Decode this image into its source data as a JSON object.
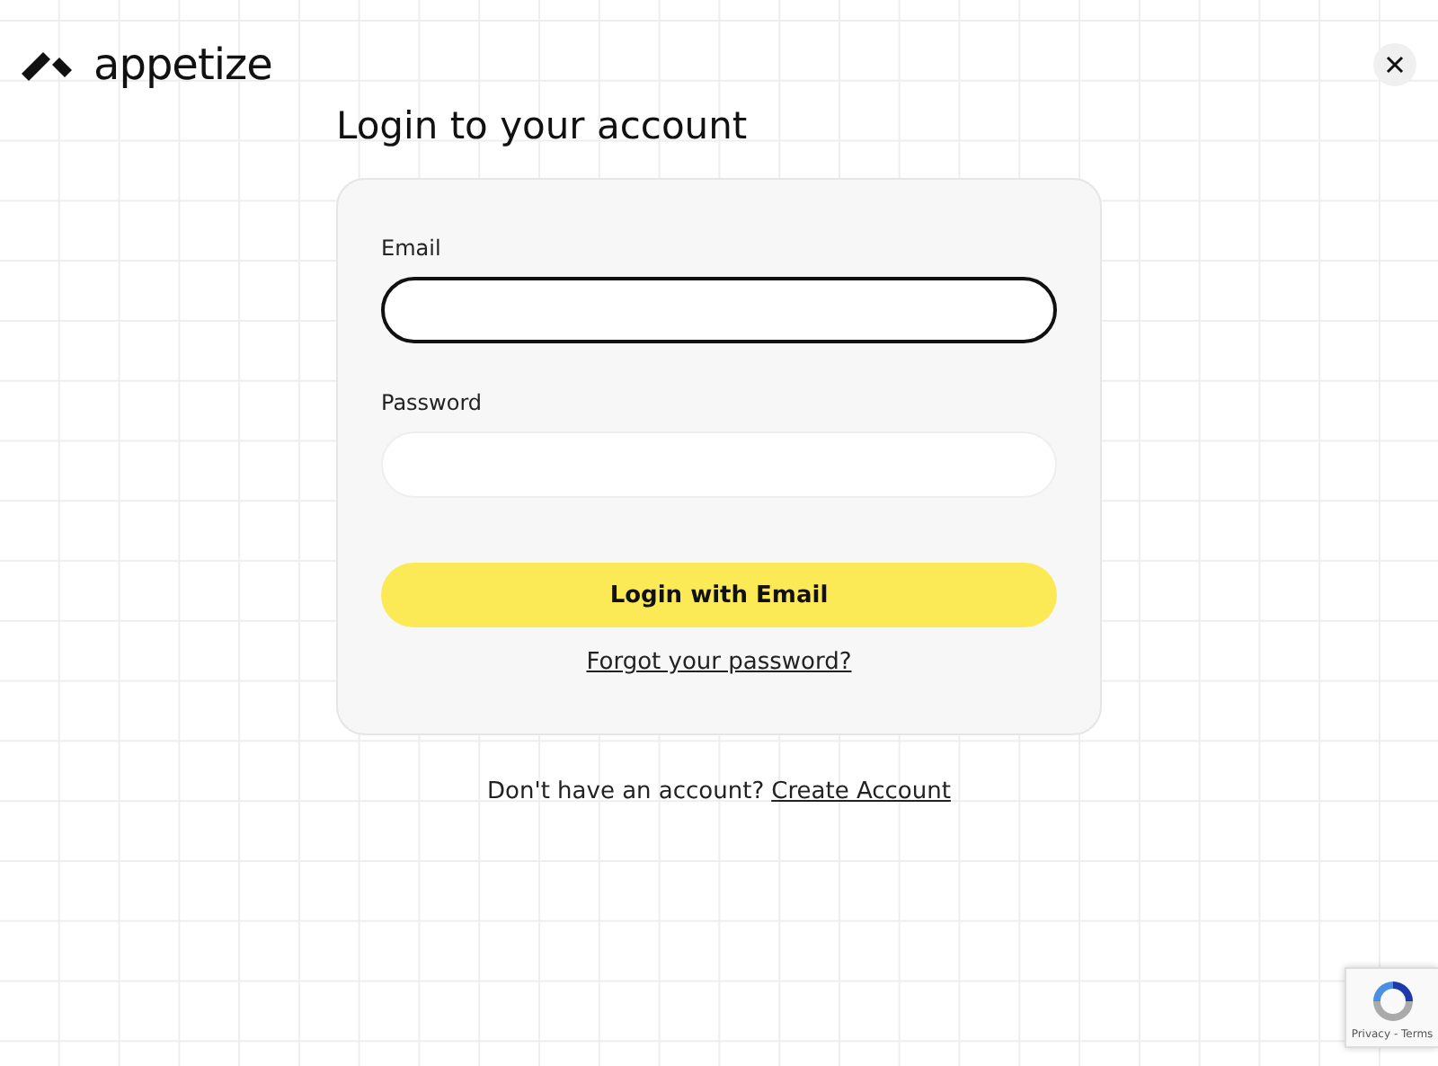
{
  "header": {
    "logo": "appetize"
  },
  "title": "Login to your account",
  "form": {
    "fields": [
      {
        "label": "Email",
        "focused": true
      },
      {
        "label": "Password",
        "focused": false
      }
    ],
    "submit": "Login with Email",
    "forgot": "Forgot your password?"
  },
  "signup": {
    "prompt": "Don't have an account?",
    "link": "Create Account"
  },
  "recaptcha": {
    "links": "Privacy - Terms"
  }
}
